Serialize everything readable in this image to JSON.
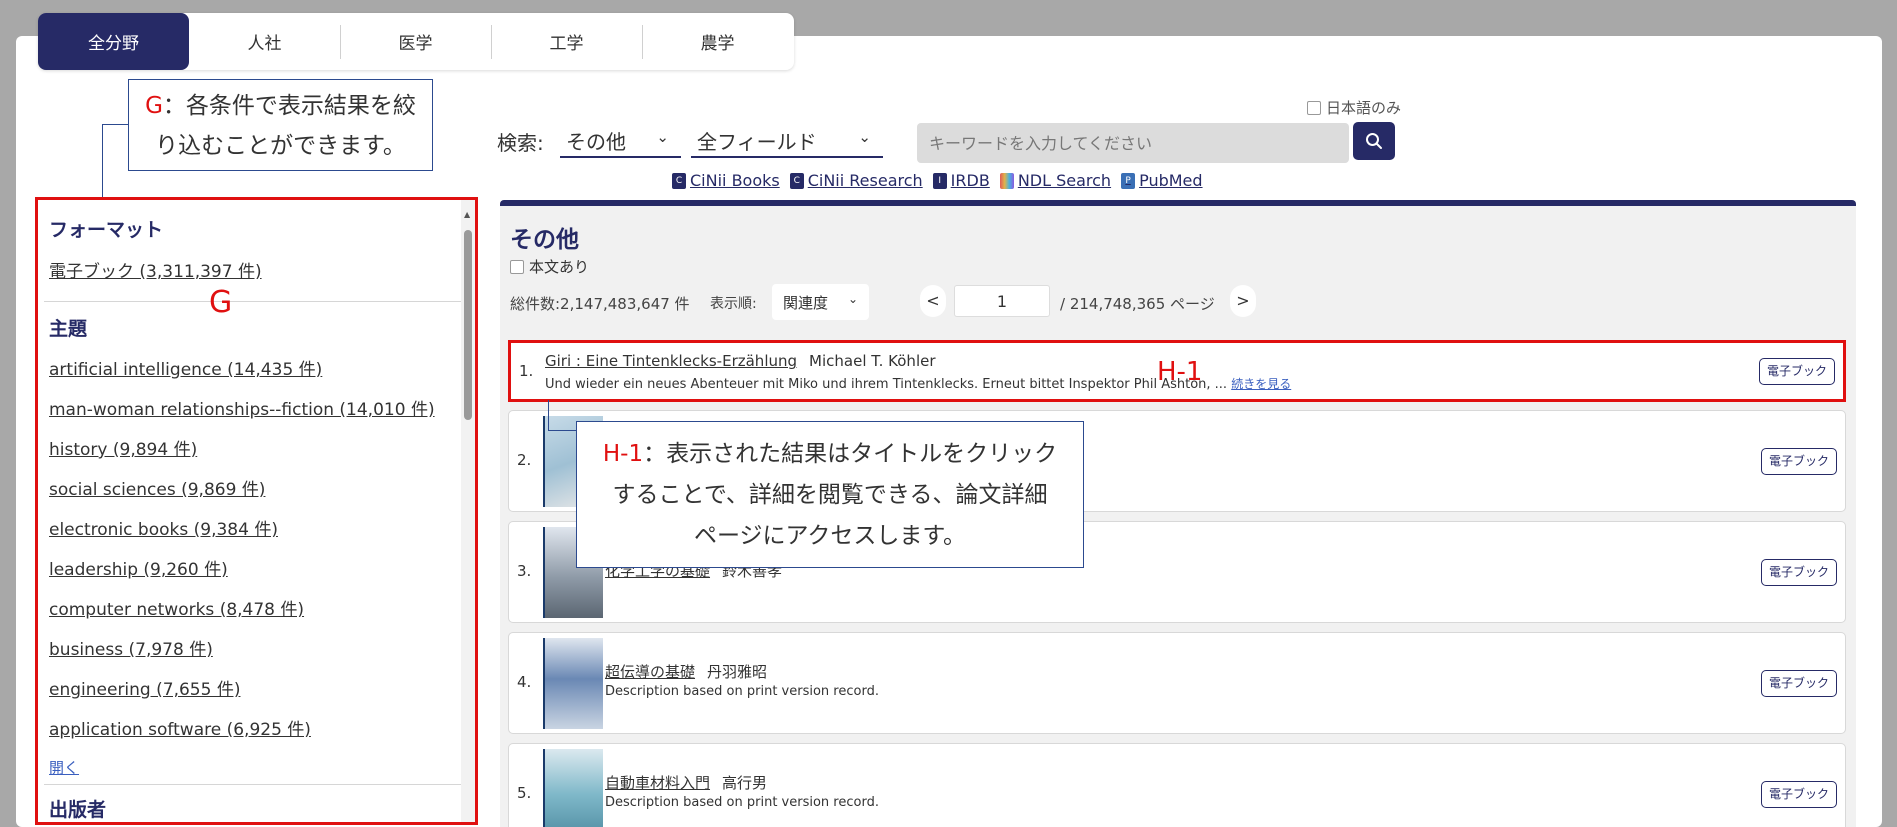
{
  "tabs": [
    "全分野",
    "人社",
    "医学",
    "工学",
    "農学"
  ],
  "callouts": {
    "g_tag": "G",
    "g_line1": "：各条件で表示結果を絞",
    "g_line2": "り込むことができます。",
    "h1_tag": "H-1",
    "h1_line1": "：表示された結果はタイトルをクリック",
    "h1_line2": "することで、詳細を閲覧できる、論文詳細",
    "h1_line3": "ページにアクセスします。"
  },
  "search": {
    "label": "検索:",
    "type_value": "その他",
    "field_value": "全フィールド",
    "japanese_only": "日本語のみ",
    "placeholder": "キーワードを入力してください"
  },
  "external_links": [
    {
      "label": "CiNii Books",
      "icon": "cinii-icon"
    },
    {
      "label": "CiNii Research",
      "icon": "cinii-icon"
    },
    {
      "label": "IRDB",
      "icon": "irdb-icon"
    },
    {
      "label": "NDL Search",
      "icon": "ndl-icon"
    },
    {
      "label": "PubMed",
      "icon": "pubmed-icon"
    }
  ],
  "sidebar": {
    "format_heading": "フォーマット",
    "format_items": [
      "電子ブック (3,311,397 件)"
    ],
    "subject_heading": "主題",
    "subject_items": [
      "artificial intelligence (14,435 件)",
      "man-woman relationships--fiction (14,010 件)",
      "history (9,894 件)",
      "social sciences (9,869 件)",
      "electronic books (9,384 件)",
      "leadership (9,260 件)",
      "computer networks (8,478 件)",
      "business (7,978 件)",
      "engineering (7,655 件)",
      "application software (6,925 件)"
    ],
    "open_link": "開く",
    "publisher_heading": "出版者",
    "g_label": "G"
  },
  "results": {
    "heading": "その他",
    "fulltext_label": "本文あり",
    "total": "総件数:2,147,483,647 件",
    "sort_label": "表示順:",
    "sort_value": "関連度",
    "prev": "<",
    "next": ">",
    "page": "1",
    "page_total": "/ 214,748,365 ページ",
    "h1_label": "H-1",
    "items": [
      {
        "num": "1.",
        "title": "Giri : Eine Tintenklecks-Erzählung",
        "author": "Michael T. Köhler",
        "desc": "Und wieder ein neues Abenteuer mit Miko und ihrem Tintenklecks. Erneut bittet Inspektor Phil Ashton, ...",
        "more": "続きを見る",
        "badge": "電子ブック"
      },
      {
        "num": "2.",
        "title": "",
        "author": "",
        "desc": "",
        "more": "",
        "badge": "電子ブック"
      },
      {
        "num": "3.",
        "title": "化学工学の基礎",
        "author": "鈴木善孝",
        "desc": "",
        "more": "",
        "badge": "電子ブック"
      },
      {
        "num": "4.",
        "title": "超伝導の基礎",
        "author": "丹羽雅昭",
        "desc": "Description based on print version record.",
        "more": "",
        "badge": "電子ブック"
      },
      {
        "num": "5.",
        "title": "自動車材料入門",
        "author": "高行男",
        "desc": "Description based on print version record.",
        "more": "",
        "badge": "電子ブック"
      }
    ]
  },
  "colors": {
    "brand": "#262a66",
    "highlight": "#e01010",
    "callout_border": "#2c4a8f"
  }
}
